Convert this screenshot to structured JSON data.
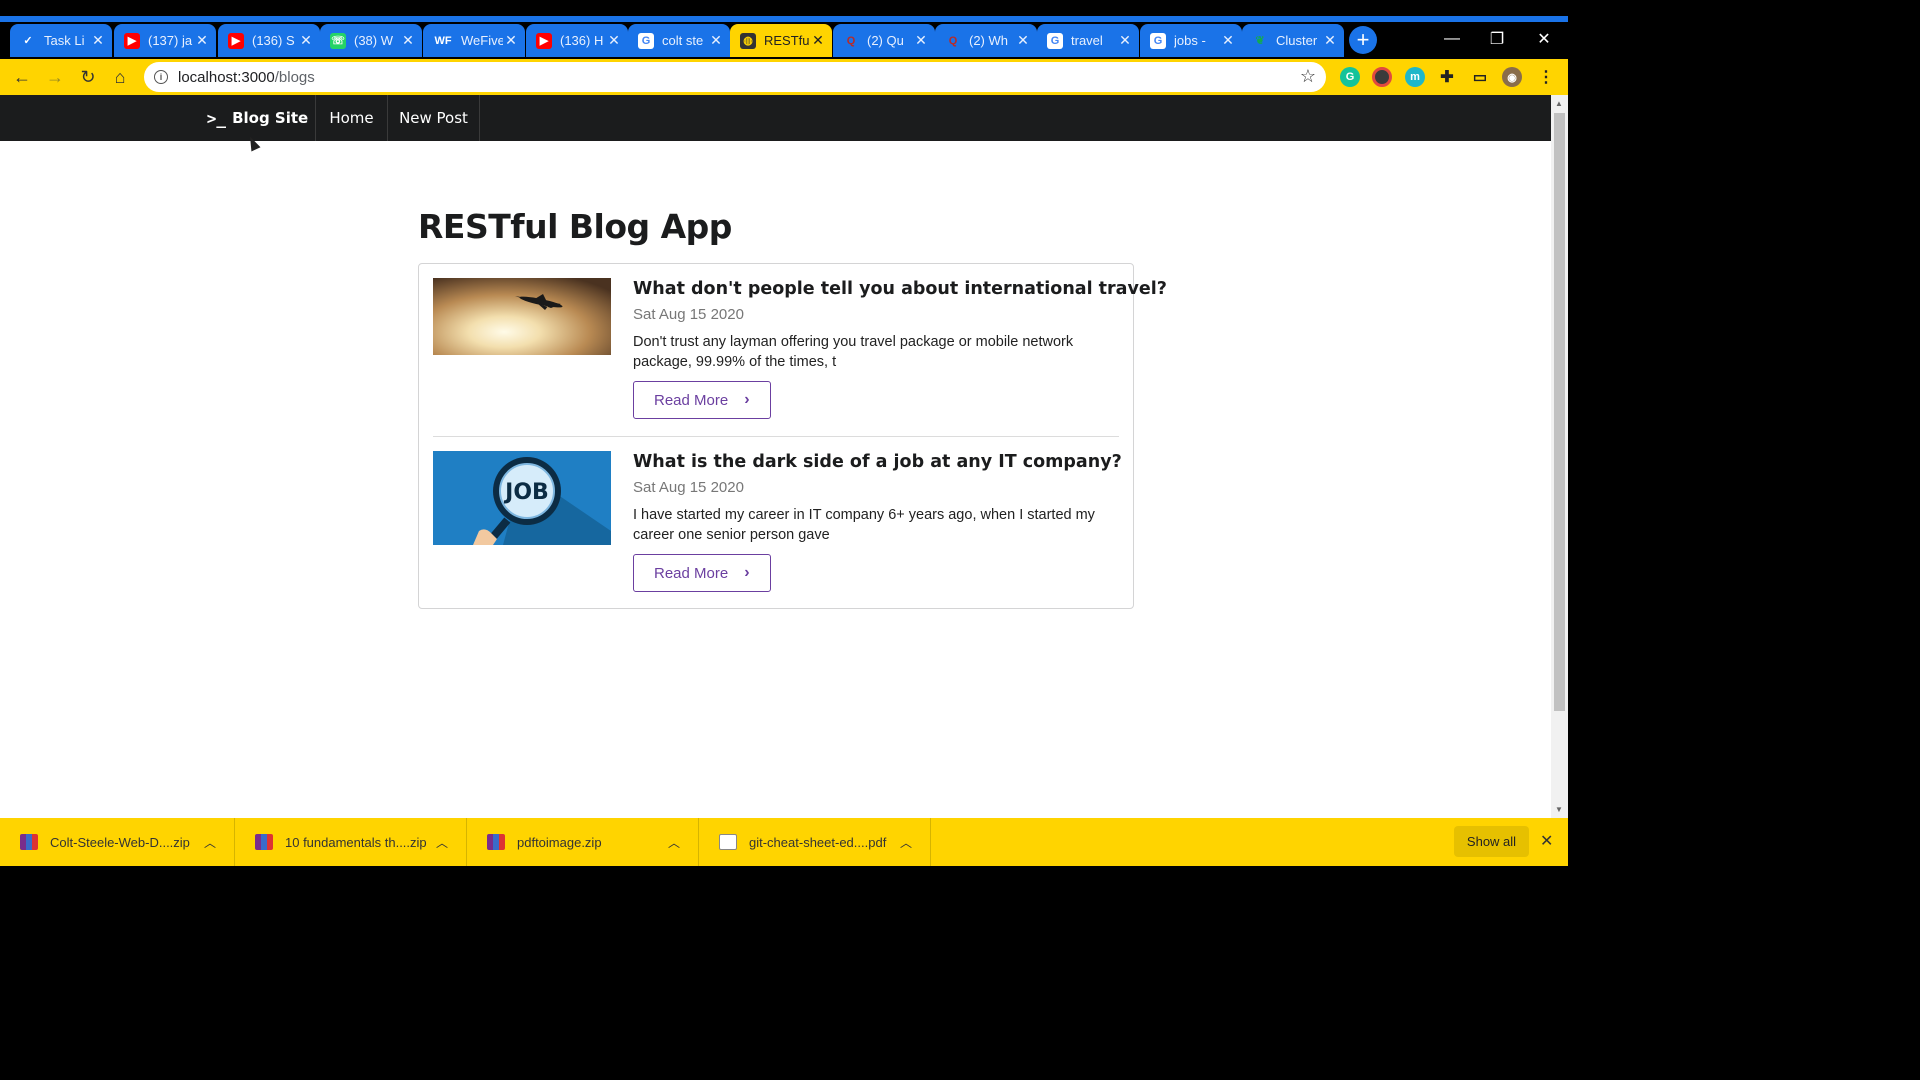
{
  "browser": {
    "tabs": [
      {
        "title": "Task Li",
        "icon": "check-icon"
      },
      {
        "title": "(137) ja",
        "icon": "youtube-icon"
      },
      {
        "title": "(136) S",
        "icon": "youtube-icon"
      },
      {
        "title": "(38) W",
        "icon": "whatsapp-icon"
      },
      {
        "title": "WeFive",
        "icon": "wefive-icon",
        "icon_text": "WF"
      },
      {
        "title": "(136) H",
        "icon": "youtube-icon"
      },
      {
        "title": "colt ste",
        "icon": "google-icon"
      },
      {
        "title": "RESTfu",
        "icon": "globe-icon",
        "active": true
      },
      {
        "title": "(2) Qu",
        "icon": "quora-icon"
      },
      {
        "title": "(2) Wh",
        "icon": "quora-icon"
      },
      {
        "title": "travel",
        "icon": "google-icon"
      },
      {
        "title": "jobs - ",
        "icon": "google-icon"
      },
      {
        "title": "Cluster",
        "icon": "mongodb-leaf-icon"
      }
    ],
    "address": {
      "host": "localhost:3000",
      "path": "/blogs"
    },
    "accent_color": "#ffd400",
    "tab_color": "#1a73e8"
  },
  "site": {
    "brand": "Blog Site",
    "brand_icon": ">_",
    "nav": {
      "home": "Home",
      "new_post": "New Post"
    },
    "title": "RESTful Blog App",
    "posts": [
      {
        "title": "What don't people tell you about international travel?",
        "date": "Sat Aug 15 2020",
        "excerpt": "Don't trust any layman offering you travel package or mobile network package, 99.99% of the times, t",
        "read_more": "Read More",
        "image": "airplane-sunset-image"
      },
      {
        "title": "What is the dark side of a job at any IT company?",
        "date": "Sat Aug 15 2020",
        "excerpt": "I have started my career in IT company 6+ years ago, when I started my career one senior person gave",
        "read_more": "Read More",
        "image": "job-magnifier-image",
        "image_text": "JOB"
      }
    ],
    "button_color": "#6b3fa0"
  },
  "downloads": {
    "items": [
      {
        "name": "Colt-Steele-Web-D....zip",
        "type": "zip"
      },
      {
        "name": "10 fundamentals th....zip",
        "type": "zip"
      },
      {
        "name": "pdftoimage.zip",
        "type": "zip"
      },
      {
        "name": "git-cheat-sheet-ed....pdf",
        "type": "pdf"
      }
    ],
    "show_all": "Show all"
  }
}
